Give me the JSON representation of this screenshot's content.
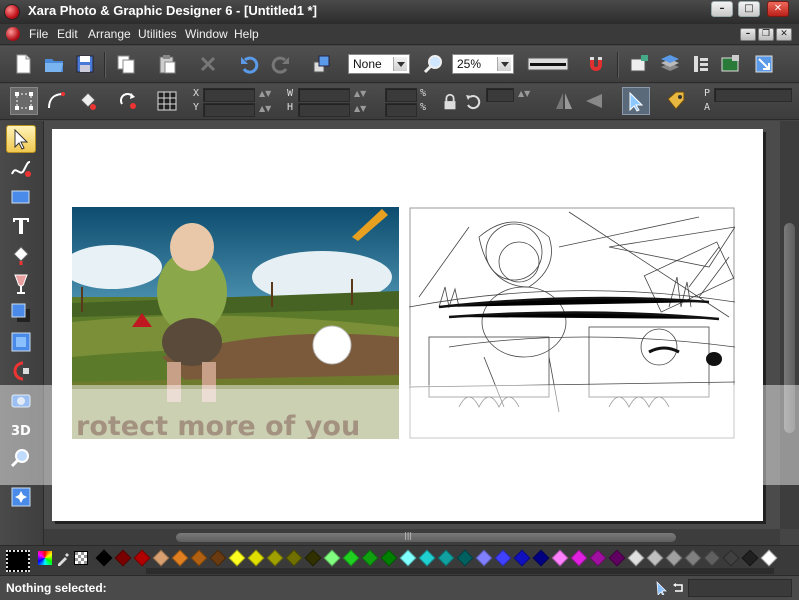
{
  "window": {
    "title": "Xara Photo & Graphic Designer 6 - [Untitled1 *]",
    "minimize": "–",
    "maximize": "□",
    "close": "✕"
  },
  "menu": {
    "items": [
      {
        "label": "File"
      },
      {
        "label": "Edit"
      },
      {
        "label": "Arrange"
      },
      {
        "label": "Utilities"
      },
      {
        "label": "Window"
      },
      {
        "label": "Help"
      }
    ],
    "doc_minimize": "–",
    "doc_restore": "❐",
    "doc_close": "✕"
  },
  "toolbar": {
    "feather_value": "None",
    "zoom_value": "25%"
  },
  "infobar": {
    "x_label": "X",
    "y_label": "Y",
    "w_label": "W",
    "h_label": "H",
    "percent_top": "%",
    "percent_bottom": "%",
    "p_label": "P",
    "a_label": "A"
  },
  "canvas": {
    "banner_text": "rotect more of you"
  },
  "palette": {
    "colors": [
      "#000000",
      "#7a0000",
      "#b00000",
      "#d8a070",
      "#e08020",
      "#b06010",
      "#6a3a10",
      "#ffff20",
      "#e0e000",
      "#a0a000",
      "#707000",
      "#303000",
      "#80ff80",
      "#20d020",
      "#10a010",
      "#008000",
      "#80ffff",
      "#20d0d0",
      "#10a0a0",
      "#006060",
      "#8080ff",
      "#4040ff",
      "#1010c0",
      "#000080",
      "#ff80ff",
      "#e020e0",
      "#a010a0",
      "#600060",
      "#e0e0e0",
      "#c0c0c0",
      "#a0a0a0",
      "#808080",
      "#606060",
      "#404040",
      "#202020",
      "#ffffff"
    ]
  },
  "status": {
    "text": "Nothing selected:"
  }
}
